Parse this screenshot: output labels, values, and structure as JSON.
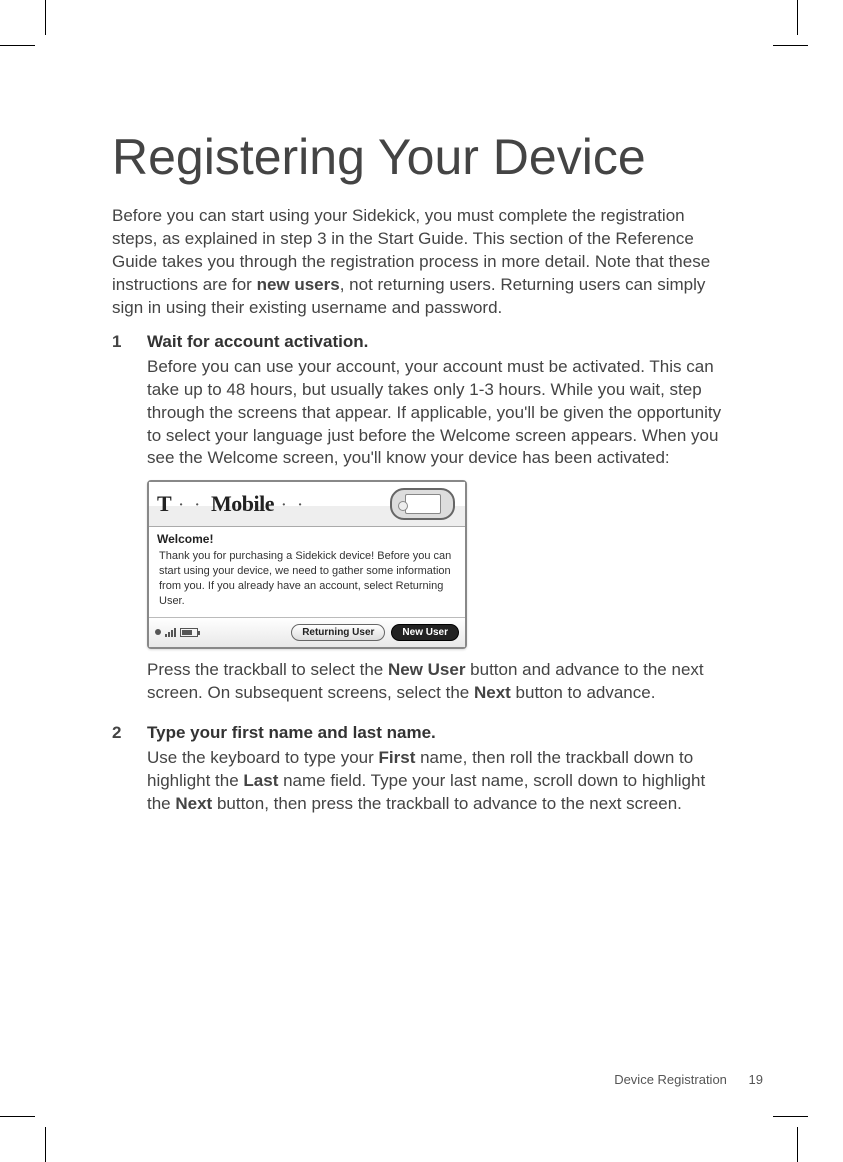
{
  "title": "Registering Your Device",
  "intro": {
    "pre": "Before you can start using your Sidekick, you must complete the registration steps, as explained in step 3 in the Start Guide. This section of the Reference Guide takes you through the registration process in more detail. Note that these instructions are for ",
    "bold": "new users",
    "post": ", not returning users. Returning users can simply sign in using their existing username and password."
  },
  "steps": [
    {
      "num": "1",
      "title": "Wait for account activation.",
      "body1": "Before you can use your account, your account must be activated. This can take up to 48 hours, but usually takes only 1-3 hours. While you wait, step through the screens that appear. If applicable, you'll be given the opportunity to select your language just before the Welcome screen appears. When you see the Welcome screen, you'll know your device has been activated:",
      "after_img": {
        "a": "Press the trackball to select the ",
        "b1": "New User",
        "c": " button and advance to the next screen. On subsequent screens, select the ",
        "b2": "Next",
        "d": " button to advance."
      }
    },
    {
      "num": "2",
      "title": "Type your first name and last name.",
      "body_parts": {
        "a": "Use the keyboard to type your ",
        "b1": "First",
        "c": " name, then roll the trackball down to highlight the ",
        "b2": "Last",
        "d": " name field. Type your last name, scroll down to highlight the ",
        "b3": "Next",
        "e": " button, then press the trackball to advance to the next screen."
      }
    }
  ],
  "device_shot": {
    "logo": "T · · Mobile · ·",
    "welcome_label": "Welcome!",
    "welcome_body": "Thank you for purchasing a Sidekick device! Before you can start using your device, we need to gather some information from you.  If you already have an account, select Returning User.",
    "btn_returning": "Returning User",
    "btn_new": "New User"
  },
  "footer": {
    "section": "Device Registration",
    "page": "19"
  }
}
